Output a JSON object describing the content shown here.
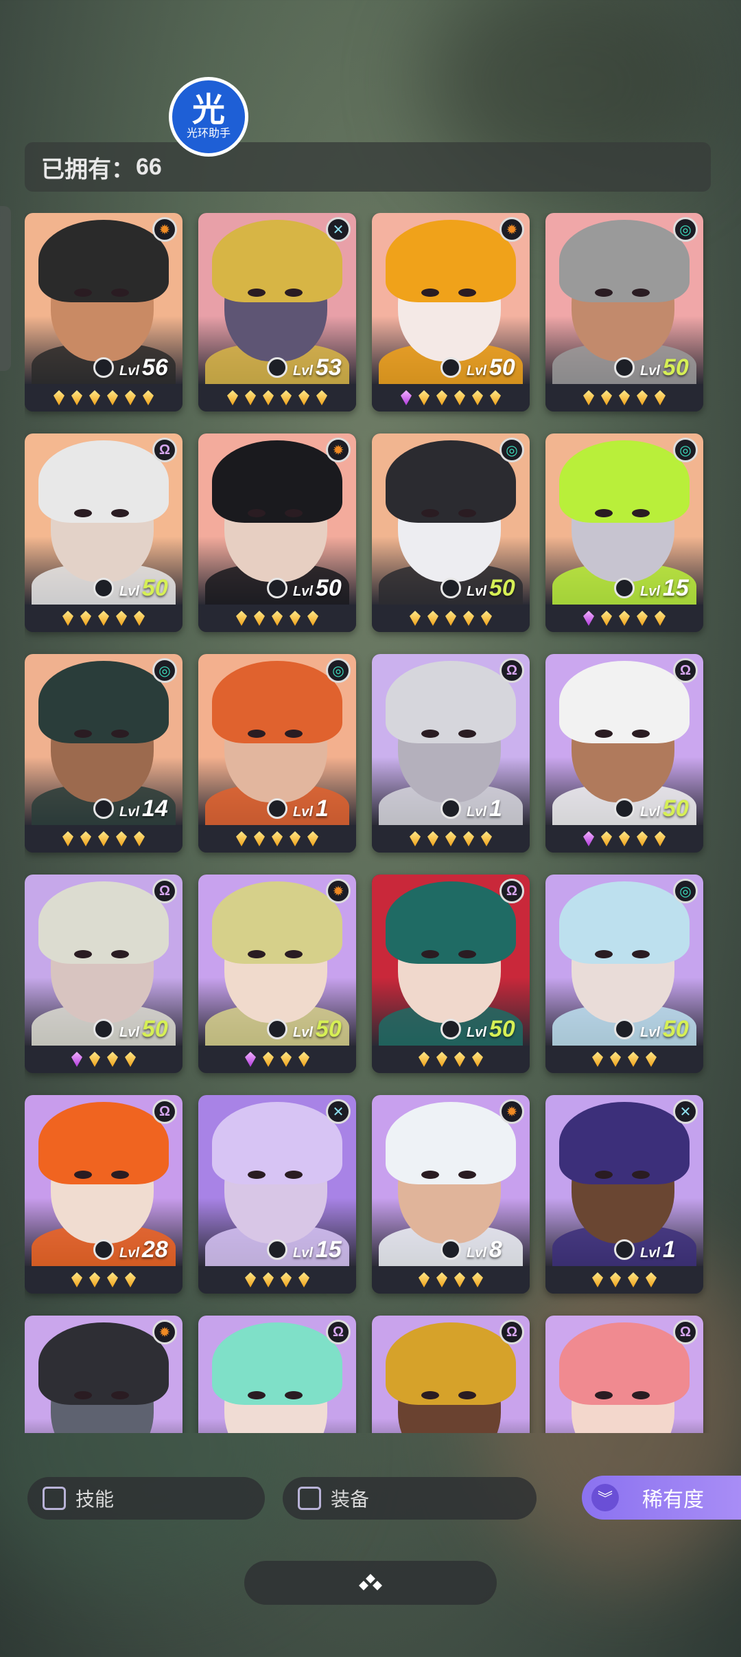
{
  "watermark": {
    "glyph": "光",
    "caption": "光环助手"
  },
  "owned": {
    "label": "已拥有：",
    "count": "66"
  },
  "lvl_prefix": "Lvl",
  "cards": [
    {
      "lvl": "56",
      "bg": "#f2b48e",
      "hair": "#2a2a2a",
      "skin": "#c98a64",
      "icon": "sun-icon",
      "icon_color": "#f08a24",
      "icon_char": "✹",
      "max": false,
      "gems": [
        "y",
        "y",
        "y",
        "y",
        "y",
        "y"
      ]
    },
    {
      "lvl": "53",
      "bg": "#e8a0a8",
      "hair": "#d7b545",
      "skin": "#5e5574",
      "icon": "cross-icon",
      "icon_color": "#8fe0f0",
      "icon_char": "✕",
      "max": false,
      "gems": [
        "y",
        "y",
        "y",
        "y",
        "y",
        "y"
      ]
    },
    {
      "lvl": "50",
      "bg": "#f4b2a0",
      "hair": "#f0a21a",
      "skin": "#f4e9e6",
      "icon": "sun-icon",
      "icon_color": "#f08a24",
      "icon_char": "✹",
      "max": false,
      "gems": [
        "p",
        "y",
        "y",
        "y",
        "y",
        "y"
      ]
    },
    {
      "lvl": "50",
      "bg": "#f0a7a8",
      "hair": "#9a9a9a",
      "skin": "#c28a6c",
      "icon": "swirl-icon",
      "icon_color": "#3de0c0",
      "icon_char": "◎",
      "max": true,
      "gems": [
        "y",
        "y",
        "y",
        "y",
        "y"
      ]
    },
    {
      "lvl": "50",
      "bg": "#f4b890",
      "hair": "#e8e8e8",
      "skin": "#e3d2c8",
      "icon": "omega-icon",
      "icon_color": "#d8a8f2",
      "icon_char": "Ω",
      "max": true,
      "gems": [
        "y",
        "y",
        "y",
        "y",
        "y"
      ]
    },
    {
      "lvl": "50",
      "bg": "#f3ab9c",
      "hair": "#1a1a1e",
      "skin": "#e7cfc2",
      "icon": "sun-icon",
      "icon_color": "#f08a24",
      "icon_char": "✹",
      "max": false,
      "gems": [
        "y",
        "y",
        "y",
        "y",
        "y"
      ]
    },
    {
      "lvl": "50",
      "bg": "#f1b590",
      "hair": "#2b2b30",
      "skin": "#ededf1",
      "icon": "swirl-icon",
      "icon_color": "#3de0c0",
      "icon_char": "◎",
      "max": true,
      "gems": [
        "y",
        "y",
        "y",
        "y",
        "y"
      ]
    },
    {
      "lvl": "15",
      "bg": "#f2b590",
      "hair": "#b9ef3a",
      "skin": "#c7c4d0",
      "icon": "swirl-icon",
      "icon_color": "#3de0c0",
      "icon_char": "◎",
      "max": false,
      "gems": [
        "p",
        "y",
        "y",
        "y",
        "y"
      ]
    },
    {
      "lvl": "14",
      "bg": "#f0b18f",
      "hair": "#2a3d3a",
      "skin": "#9c6a4e",
      "icon": "swirl-icon",
      "icon_color": "#3de0c0",
      "icon_char": "◎",
      "max": false,
      "gems": [
        "y",
        "y",
        "y",
        "y",
        "y"
      ]
    },
    {
      "lvl": "1",
      "bg": "#f3b08e",
      "hair": "#e0622e",
      "skin": "#e2b69e",
      "icon": "swirl-icon",
      "icon_color": "#3de0c0",
      "icon_char": "◎",
      "max": false,
      "gems": [
        "y",
        "y",
        "y",
        "y",
        "y"
      ]
    },
    {
      "lvl": "1",
      "bg": "#cbb1ee",
      "hair": "#d6d6dc",
      "skin": "#b4b0bc",
      "icon": "omega-icon",
      "icon_color": "#d8a8f2",
      "icon_char": "Ω",
      "max": false,
      "gems": [
        "y",
        "y",
        "y",
        "y",
        "y"
      ]
    },
    {
      "lvl": "50",
      "bg": "#cba7ef",
      "hair": "#f2f2f2",
      "skin": "#b07a5c",
      "icon": "omega-icon",
      "icon_color": "#d8a8f2",
      "icon_char": "Ω",
      "max": true,
      "gems": [
        "p",
        "y",
        "y",
        "y",
        "y"
      ]
    },
    {
      "lvl": "50",
      "bg": "#c6a8ea",
      "hair": "#dcdcd0",
      "skin": "#d8c4c0",
      "icon": "omega-icon",
      "icon_color": "#d8a8f2",
      "icon_char": "Ω",
      "max": true,
      "gems": [
        "p",
        "y",
        "y",
        "y"
      ]
    },
    {
      "lvl": "50",
      "bg": "#c8a2ee",
      "hair": "#d6d08a",
      "skin": "#f0dacc",
      "icon": "sun-icon",
      "icon_color": "#f08a24",
      "icon_char": "✹",
      "max": true,
      "gems": [
        "p",
        "y",
        "y",
        "y"
      ]
    },
    {
      "lvl": "50",
      "bg": "#c9283a",
      "hair": "#1f6b64",
      "skin": "#f0d8cc",
      "icon": "omega-icon",
      "icon_color": "#d8a8f2",
      "icon_char": "Ω",
      "max": true,
      "gems": [
        "y",
        "y",
        "y",
        "y"
      ]
    },
    {
      "lvl": "50",
      "bg": "#c6a4ee",
      "hair": "#bde0ee",
      "skin": "#e9dcd8",
      "icon": "swirl-icon",
      "icon_color": "#3de0c0",
      "icon_char": "◎",
      "max": true,
      "gems": [
        "y",
        "y",
        "y",
        "y"
      ]
    },
    {
      "lvl": "28",
      "bg": "#c89cec",
      "hair": "#f06420",
      "skin": "#f0dcd0",
      "icon": "omega-icon",
      "icon_color": "#d8a8f2",
      "icon_char": "Ω",
      "max": false,
      "gems": [
        "y",
        "y",
        "y",
        "y"
      ]
    },
    {
      "lvl": "15",
      "bg": "#a883e6",
      "hair": "#d7c4f4",
      "skin": "#d8c6e6",
      "icon": "cross-icon",
      "icon_color": "#8fe0f0",
      "icon_char": "✕",
      "max": false,
      "gems": [
        "y",
        "y",
        "y",
        "y"
      ]
    },
    {
      "lvl": "8",
      "bg": "#c8a0ee",
      "hair": "#eef2f6",
      "skin": "#e0b49a",
      "icon": "sun-icon",
      "icon_color": "#f08a24",
      "icon_char": "✹",
      "max": false,
      "gems": [
        "y",
        "y",
        "y",
        "y"
      ]
    },
    {
      "lvl": "1",
      "bg": "#c4a2ee",
      "hair": "#3c2f7a",
      "skin": "#6a4632",
      "icon": "cross-icon",
      "icon_color": "#8fe0f0",
      "icon_char": "✕",
      "max": false,
      "gems": [
        "y",
        "y",
        "y",
        "y"
      ]
    },
    {
      "lvl": "",
      "bg": "#caa6ec",
      "hair": "#2e2e34",
      "skin": "#5e6270",
      "icon": "sun-icon",
      "icon_color": "#f08a24",
      "icon_char": "✹",
      "max": false,
      "gems": []
    },
    {
      "lvl": "",
      "bg": "#c7a3ec",
      "hair": "#7fe0c8",
      "skin": "#f0dcd4",
      "icon": "omega-icon",
      "icon_color": "#d8a8f2",
      "icon_char": "Ω",
      "max": false,
      "gems": []
    },
    {
      "lvl": "",
      "bg": "#c9a3ec",
      "hair": "#d6a22a",
      "skin": "#6a4230",
      "icon": "omega-icon",
      "icon_color": "#d8a8f2",
      "icon_char": "Ω",
      "max": false,
      "gems": []
    },
    {
      "lvl": "",
      "bg": "#cda7ee",
      "hair": "#f08a90",
      "skin": "#f3d7cc",
      "icon": "omega-icon",
      "icon_color": "#d8a8f2",
      "icon_char": "Ω",
      "max": false,
      "gems": []
    }
  ],
  "filters": {
    "skill": "技能",
    "equipment": "装备",
    "rarity": "稀有度",
    "rarity_icon": "chevrons-down-icon",
    "collapse_icon": "diamond-cluster-icon"
  }
}
